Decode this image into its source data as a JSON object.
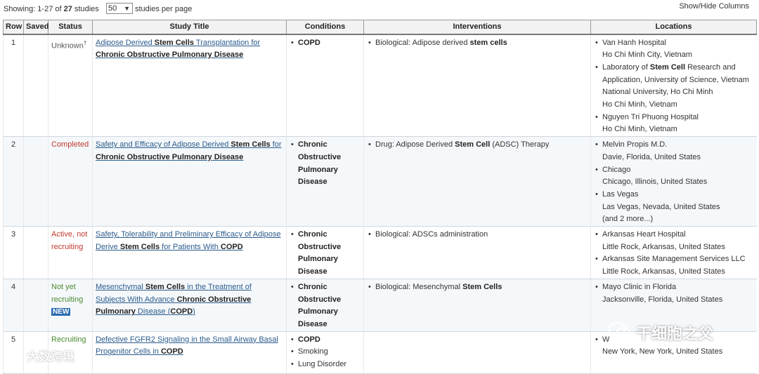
{
  "header": {
    "showing_prefix": "Showing: 1-27 of",
    "total": "27",
    "showing_suffix": "studies",
    "per_page_value": "50",
    "per_page_label": "studies per page",
    "show_hide": "Show/Hide Columns"
  },
  "columns": {
    "row": "Row",
    "saved": "Saved",
    "status": "Status",
    "title": "Study Title",
    "conditions": "Conditions",
    "interventions": "Interventions",
    "locations": "Locations"
  },
  "rows": [
    {
      "num": "1",
      "saved": "",
      "status": "Unknown",
      "status_sup": "†",
      "title_parts": [
        {
          "text": "Adipose Derived",
          "hl": false
        },
        {
          "text": " Stem Cells",
          "hl": true
        },
        {
          "text": " Transplantation for ",
          "hl": false
        },
        {
          "text": "Chronic Obstructive Pulmonary Disease",
          "hl": true
        }
      ],
      "conditions": [
        {
          "text": "COPD",
          "bold": true
        }
      ],
      "interventions": [
        {
          "parts": [
            {
              "text": "Biological: Adipose derived ",
              "hl": false
            },
            {
              "text": "stem cells",
              "hl": true
            }
          ]
        }
      ],
      "locations": [
        {
          "name_parts": [
            {
              "text": "Van Hanh Hospital",
              "hl": false
            }
          ],
          "place": "Ho Chi Minh City, Vietnam"
        },
        {
          "name_parts": [
            {
              "text": "Laboratory of ",
              "hl": false
            },
            {
              "text": "Stem Cell",
              "hl": true
            },
            {
              "text": " Research and Application, University of Science, Vietnam National University, Ho Chi Minh",
              "hl": false
            }
          ],
          "place": "Ho Chi Minh, Vietnam"
        },
        {
          "name_parts": [
            {
              "text": "Nguyen Tri Phuong Hospital",
              "hl": false
            }
          ],
          "place": "Ho Chi Minh, Vietnam"
        }
      ]
    },
    {
      "num": "2",
      "saved": "",
      "status": "Completed",
      "title_parts": [
        {
          "text": "Safety and Efficacy of Adipose Derived ",
          "hl": false
        },
        {
          "text": "Stem Cells",
          "hl": true
        },
        {
          "text": " for ",
          "hl": false
        },
        {
          "text": "Chronic Obstructive Pulmonary Disease",
          "hl": true
        }
      ],
      "conditions": [
        {
          "text": "Chronic Obstructive Pulmonary Disease",
          "bold": true
        }
      ],
      "interventions": [
        {
          "parts": [
            {
              "text": "Drug: Adipose Derived ",
              "hl": false
            },
            {
              "text": "Stem Cell",
              "hl": true
            },
            {
              "text": " (ADSC) Therapy",
              "hl": false
            }
          ]
        }
      ],
      "locations": [
        {
          "name_parts": [
            {
              "text": "Melvin Propis M.D.",
              "hl": false
            }
          ],
          "place": "Davie, Florida, United States"
        },
        {
          "name_parts": [
            {
              "text": "Chicago",
              "hl": false
            }
          ],
          "place": "Chicago, Illinois, United States"
        },
        {
          "name_parts": [
            {
              "text": "Las Vegas",
              "hl": false
            }
          ],
          "place": "Las Vegas, Nevada, United States"
        }
      ],
      "locations_more": "(and 2 more...)"
    },
    {
      "num": "3",
      "saved": "",
      "status": "Active, not recruiting",
      "title_parts": [
        {
          "text": "Safety, Tolerability and Preliminary Efficacy of Adipose Derive ",
          "hl": false
        },
        {
          "text": "Stem Cells",
          "hl": true
        },
        {
          "text": " for Patients With ",
          "hl": false
        },
        {
          "text": "COPD",
          "hl": true
        }
      ],
      "conditions": [
        {
          "text": "Chronic Obstructive Pulmonary Disease",
          "bold": true
        }
      ],
      "interventions": [
        {
          "parts": [
            {
              "text": "Biological: ADSCs administration",
              "hl": false
            }
          ]
        }
      ],
      "locations": [
        {
          "name_parts": [
            {
              "text": "Arkansas Heart Hospital",
              "hl": false
            }
          ],
          "place": "Little Rock, Arkansas, United States"
        },
        {
          "name_parts": [
            {
              "text": "Arkansas Site Management Services LLC",
              "hl": false
            }
          ],
          "place": "Little Rock, Arkansas, United States"
        }
      ]
    },
    {
      "num": "4",
      "saved": "",
      "status": "Not yet recruiting",
      "status_badge": "NEW",
      "title_parts": [
        {
          "text": "Mesenchymal ",
          "hl": false
        },
        {
          "text": "Stem Cells",
          "hl": true
        },
        {
          "text": " in the Treatment of Subjects With Advance ",
          "hl": false
        },
        {
          "text": "Chronic Obstructive Pulmonary",
          "hl": true
        },
        {
          "text": " Disease (",
          "hl": false
        },
        {
          "text": "COPD",
          "hl": true
        },
        {
          "text": ")",
          "hl": false
        }
      ],
      "conditions": [
        {
          "text": "Chronic Obstructive Pulmonary Disease",
          "bold": true
        }
      ],
      "interventions": [
        {
          "parts": [
            {
              "text": "Biological: Mesenchymal ",
              "hl": false
            },
            {
              "text": "Stem Cells",
              "hl": true
            }
          ]
        }
      ],
      "locations": [
        {
          "name_parts": [
            {
              "text": "Mayo Clinic in Florida",
              "hl": false
            }
          ],
          "place": "Jacksonville, Florida, United States"
        }
      ]
    },
    {
      "num": "5",
      "saved": "",
      "status": "Recruiting",
      "title_parts": [
        {
          "text": "Defective FGFR2 Signaling in the Small Airway Basal Progenitor Cells in ",
          "hl": false
        },
        {
          "text": "COPD",
          "hl": true
        }
      ],
      "conditions": [
        {
          "text": "COPD",
          "bold": true
        },
        {
          "text": "Smoking",
          "bold": false
        },
        {
          "text": "Lung Disorder",
          "bold": false
        }
      ],
      "interventions": [],
      "locations": [
        {
          "name_parts": [
            {
              "text": "W",
              "hl": false
            }
          ],
          "place": "New York, New York, United States"
        }
      ]
    }
  ],
  "watermark_left": "大数跨境",
  "watermark_right": "干细胞之父"
}
